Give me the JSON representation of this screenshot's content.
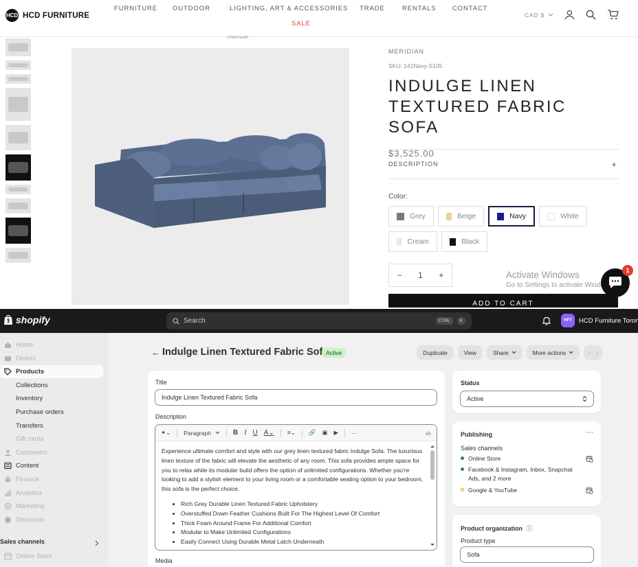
{
  "store": {
    "logo_mark": "HCD",
    "logo_text": "HCD FURNITURE",
    "nav": [
      "FURNITURE",
      "OUTDOOR",
      "LIGHTING, ART & ACCESSORIES",
      "TRADE",
      "RENTALS",
      "CONTACT"
    ],
    "sale": "SALE",
    "currency": "CAD $",
    "image_caption": "Underneath",
    "vendor": "MERIDIAN",
    "sku": "SKU: 141Navy-S105",
    "title_line1": "INDULGE LINEN",
    "title_line2": "TEXTURED FABRIC SOFA",
    "price": "$3,525.00",
    "description_label": "DESCRIPTION",
    "plus": "+",
    "color_label": "Color:",
    "colors": [
      {
        "name": "Grey",
        "hex": "#7a7a7a"
      },
      {
        "name": "Beige",
        "hex": "#e8d49a"
      },
      {
        "name": "Navy",
        "hex": "#1a1a8c"
      },
      {
        "name": "White",
        "hex": "#ffffff"
      },
      {
        "name": "Cream",
        "hex": "#efeae2"
      },
      {
        "name": "Black",
        "hex": "#111111"
      }
    ],
    "selected_color": "Navy",
    "qty_minus": "−",
    "qty": "1",
    "qty_plus": "+",
    "add_to_cart": "ADD TO CART",
    "activate_title": "Activate Windows",
    "activate_sub": "Go to Settings to activate Windows.",
    "chat_badge": "1"
  },
  "admin": {
    "brand": "shopify",
    "search_placeholder": "Search",
    "kbd1": "CTRL",
    "kbd2": "K",
    "store_initials": "HFT",
    "store_name": "HCD Furniture Toronto",
    "nav": [
      {
        "label": "Home",
        "faded": true,
        "icon": "home-icon"
      },
      {
        "label": "Orders",
        "faded": true,
        "icon": "orders-icon"
      },
      {
        "label": "Products",
        "active": true,
        "icon": "tag-icon"
      },
      {
        "label": "Collections",
        "sub": true
      },
      {
        "label": "Inventory",
        "sub": true
      },
      {
        "label": "Purchase orders",
        "sub": true
      },
      {
        "label": "Transfers",
        "sub": true
      },
      {
        "label": "Gift cards",
        "sub": true,
        "faded": true
      },
      {
        "label": "Customers",
        "faded": true,
        "icon": "person-icon"
      },
      {
        "label": "Content",
        "icon": "content-icon"
      },
      {
        "label": "Finance",
        "faded": true,
        "icon": "bank-icon"
      },
      {
        "label": "Analytics",
        "faded": true,
        "icon": "chart-icon"
      },
      {
        "label": "Marketing",
        "faded": true,
        "icon": "target-icon"
      },
      {
        "label": "Discounts",
        "faded": true,
        "icon": "discount-icon"
      }
    ],
    "sales_channels_label": "Sales channels",
    "online_store": "Online Store",
    "product_title": "Indulge Linen Textured Fabric Sofa",
    "status_badge": "Active",
    "buttons": {
      "duplicate": "Duplicate",
      "view": "View",
      "share": "Share",
      "more": "More actions"
    },
    "title_label": "Title",
    "title_value": "Indulge Linen Textured Fabric Sofa",
    "description_label": "Description",
    "paragraph": "Paragraph",
    "description_text": "Experience ultimate comfort and style with our grey linen textured fabric Indulge Sofa. The luxurious linen texture of the fabric will elevate the aesthetic of any room. This sofa provides ample space for you to relax while its modular build offers the option of unlimited configurations. Whether you're looking to add a stylish element to your living room or a comfortable seating option to your bedroom, this sofa is the perfect choice.",
    "bullets": [
      "Rich Grey Durable Linen Textured Fabric Upholstery",
      "Overstuffed Down Feather Cushions Built For The Highest Level Of Comfort",
      "Thick Foam Around Frame For Additional Comfort",
      "Modular to Make Unlimited Configurations",
      "Easily Connect Using Durable Metal Latch Underneath"
    ],
    "media_label": "Media",
    "status_label": "Status",
    "status_value": "Active",
    "publishing_label": "Publishing",
    "more_dots": "···",
    "sales_channels_sub": "Sales channels",
    "channels": [
      {
        "name": "Online Store",
        "color": "#29845a"
      },
      {
        "name": "Facebook & Instagram, Inbox, Snapchat Ads, and 2 more",
        "color": "#29845a"
      },
      {
        "name": "Google & YouTube",
        "color": "#e0a100"
      }
    ],
    "product_org_label": "Product organization",
    "info_glyph": "ⓘ",
    "product_type_label": "Product type",
    "product_type_value": "Sofa"
  }
}
